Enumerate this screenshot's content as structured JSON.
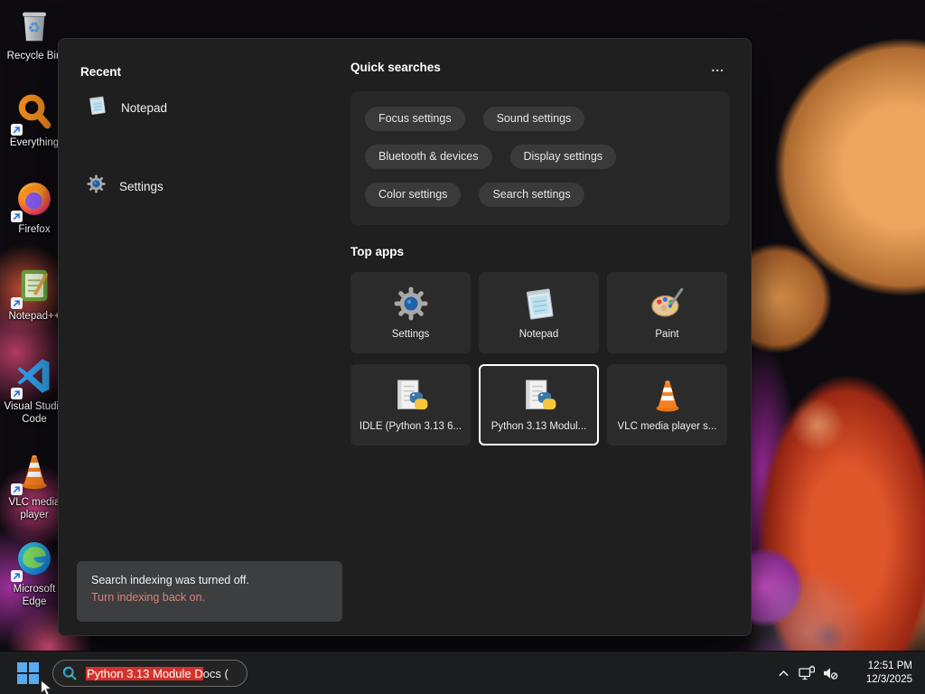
{
  "desktop": {
    "icons": [
      {
        "name": "recycle-bin",
        "lines": [
          "Recycle Bin",
          ""
        ]
      },
      {
        "name": "everything",
        "lines": [
          "Everything",
          ""
        ]
      },
      {
        "name": "firefox",
        "lines": [
          "Firefox",
          ""
        ]
      },
      {
        "name": "notepad-plus-plus",
        "lines": [
          "Notepad++",
          ""
        ]
      },
      {
        "name": "visual-studio-code",
        "lines": [
          "Visual Studio",
          "Code"
        ]
      },
      {
        "name": "vlc-media-player",
        "lines": [
          "VLC media",
          "player"
        ]
      },
      {
        "name": "microsoft-edge",
        "lines": [
          "Microsoft",
          "Edge"
        ]
      }
    ]
  },
  "search_panel": {
    "recent": {
      "header": "Recent",
      "items": [
        {
          "label": "Notepad"
        },
        {
          "label": "Settings"
        }
      ]
    },
    "quick_searches": {
      "header": "Quick searches",
      "more_label": "...",
      "pills": [
        "Focus settings",
        "Sound settings",
        "Bluetooth & devices",
        "Display settings",
        "Color settings",
        "Search settings"
      ]
    },
    "top_apps": {
      "header": "Top apps",
      "tiles": [
        {
          "label": "Settings",
          "selected": false
        },
        {
          "label": "Notepad",
          "selected": false
        },
        {
          "label": "Paint",
          "selected": false
        },
        {
          "label": "IDLE (Python 3.13 6...",
          "selected": false
        },
        {
          "label": "Python 3.13 Modul...",
          "selected": true
        },
        {
          "label": "VLC media player s...",
          "selected": false
        }
      ]
    },
    "indexing_notice": {
      "message": "Search indexing was turned off.",
      "link_label": "Turn indexing back on."
    }
  },
  "taskbar": {
    "search_box": {
      "selected_text": "Python 3.13 Module D",
      "rest_text": "ocs ("
    },
    "clock": {
      "time": "12:51 PM",
      "date": "12/3/2025"
    }
  },
  "colors": {
    "selection_highlight": "#d0342c",
    "notice_link": "#d9827a",
    "start_blue": "#58abee",
    "panel_background": "#1f1f1f",
    "taskbar_background": "#1c1d1f"
  }
}
